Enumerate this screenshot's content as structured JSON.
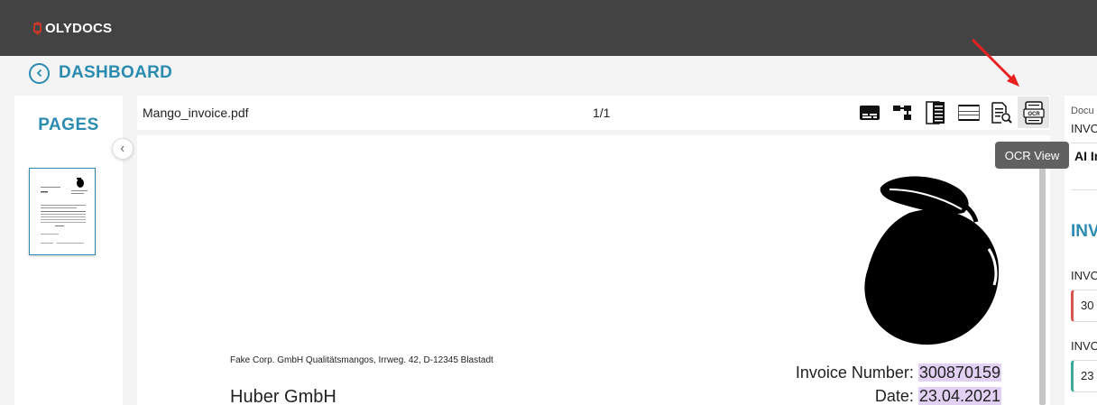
{
  "app": {
    "brand": "OLYDOCS",
    "brand_color": "#c0392b",
    "topbar_color": "#434343",
    "accent_color": "#2b8bb0"
  },
  "nav": {
    "back_label": "DASHBOARD",
    "back_icon": "chevron-left-circle-icon"
  },
  "pages_panel": {
    "title": "PAGES",
    "collapse_icon": "chevron-left-icon",
    "thumbnails": [
      {
        "page": 1,
        "selected": true
      }
    ]
  },
  "viewer": {
    "filename": "Mango_invoice.pdf",
    "page_counter": "1/1",
    "tools": [
      {
        "icon": "subtitles-view-icon",
        "active": false
      },
      {
        "icon": "tree-view-icon",
        "active": false
      },
      {
        "icon": "lines-view-icon",
        "active": false
      },
      {
        "icon": "table-view-icon",
        "active": false
      },
      {
        "icon": "document-search-icon",
        "active": false
      },
      {
        "icon": "ocr-view-icon",
        "active": true
      }
    ],
    "tooltip": "OCR View",
    "annotation_arrow_color": "#e8211f"
  },
  "document": {
    "sender_line": "Fake Corp. GmbH Qualitätsmangos, Irrweg. 42, D-12345 Blastadt",
    "recipient": "Huber GmbH",
    "invoice_number_label": "Invoice Number:",
    "invoice_number": "300870159",
    "date_label": "Date:",
    "date": "23.04.2021",
    "highlight_color": "#e3d1f4",
    "logo_icon": "mango-icon"
  },
  "right_panel": {
    "doc_label": "Docu",
    "doc_value": "INVO",
    "ai_label": "AI In",
    "section_title": "INV",
    "fields": [
      {
        "label": "INVO",
        "value": "30",
        "status_color": "#d9534f"
      },
      {
        "label": "INVO",
        "value": "23",
        "status_color": "#3ca99a"
      }
    ]
  }
}
